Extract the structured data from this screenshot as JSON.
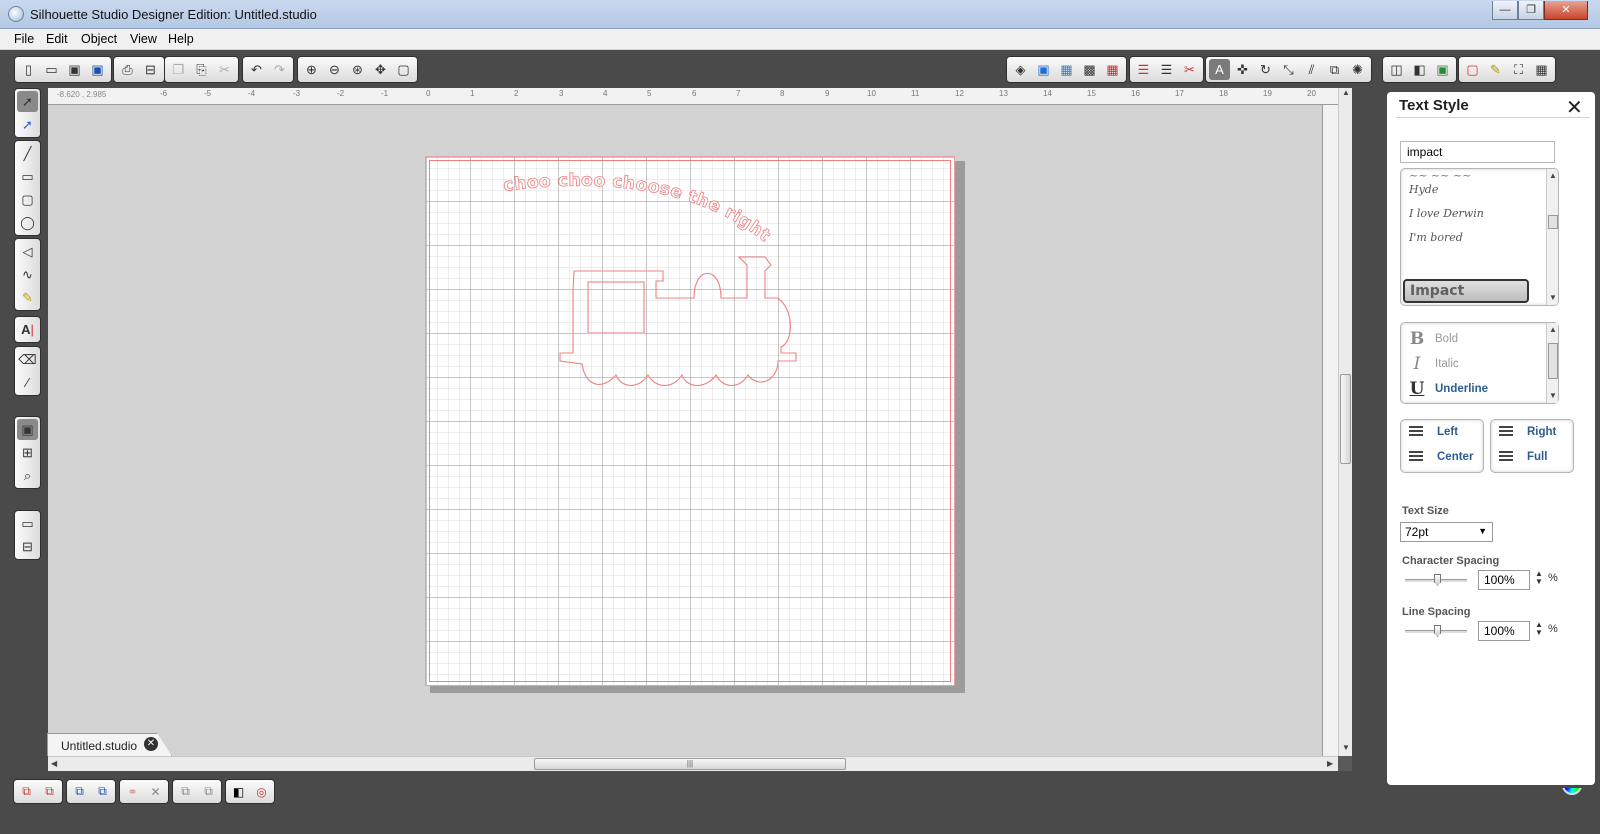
{
  "window": {
    "title": "Silhouette Studio Designer Edition: Untitled.studio",
    "minimize": "—",
    "maximize": "❐",
    "close": "✕"
  },
  "menu": [
    "File",
    "Edit",
    "Object",
    "View",
    "Help"
  ],
  "ruler": {
    "coords": "-8.620 , 2.985",
    "labels": [
      "-6",
      "-5",
      "-4",
      "-3",
      "-2",
      "-1",
      "0",
      "1",
      "2",
      "3",
      "4",
      "5",
      "6",
      "7",
      "8",
      "9",
      "10",
      "11",
      "12",
      "13",
      "14",
      "15",
      "16",
      "17",
      "18",
      "19",
      "20"
    ]
  },
  "canvas": {
    "arc_text": "choo choo choose the right",
    "page_color": "#ffffff",
    "cut_line_color": "#f08080"
  },
  "document_tab": {
    "label": "Untitled.studio",
    "close": "✕"
  },
  "text_style_panel": {
    "title": "Text Style",
    "close": "✕",
    "font_search_value": "impact",
    "font_list": [
      "Hyde",
      "I love Derwin",
      "I'm bored",
      "Impact"
    ],
    "selected_font": "Impact",
    "styles": [
      {
        "glyph": "B",
        "label": "Bold"
      },
      {
        "glyph": "I",
        "label": "Italic"
      },
      {
        "glyph": "U",
        "label": "Underline"
      }
    ],
    "alignment": {
      "left": "Left",
      "center": "Center",
      "right": "Right",
      "full": "Full"
    },
    "text_size_label": "Text Size",
    "text_size_value": "72pt",
    "char_spacing_label": "Character Spacing",
    "char_spacing_value": "100%",
    "line_spacing_label": "Line Spacing",
    "line_spacing_value": "100%",
    "percent": "%"
  },
  "icons": {
    "toolbar": [
      "new-file-icon",
      "open-icon",
      "save-icon",
      "save-to-library-icon",
      "print-icon",
      "print-cut-icon",
      "copy-icon",
      "paste-icon",
      "cut-icon",
      "undo-icon",
      "redo-icon",
      "zoom-in-icon",
      "zoom-out-icon",
      "zoom-select-icon",
      "drag-zoom-icon",
      "fit-to-page-icon"
    ],
    "accent": "#f08080"
  }
}
